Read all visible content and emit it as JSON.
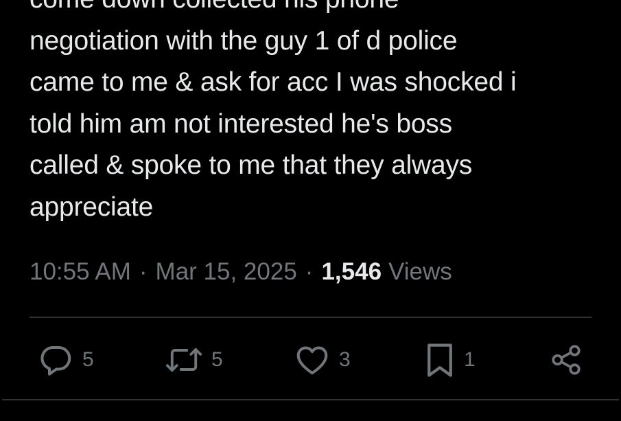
{
  "tweet": {
    "text_lines": [
      "come down collected his phone",
      "negotiation with the guy 1 of d police",
      "came to me & ask for acc I was shocked i",
      "told him am not interested he's boss",
      "called & spoke to me that they always",
      "appreciate"
    ],
    "time": "10:55 AM",
    "separator": "·",
    "date": "Mar 15, 2025",
    "views_count": "1,546",
    "views_label": "Views"
  },
  "actions": {
    "reply": {
      "icon": "reply-icon",
      "count": "5"
    },
    "repost": {
      "icon": "repost-icon",
      "count": "5"
    },
    "like": {
      "icon": "heart-icon",
      "count": "3"
    },
    "bookmark": {
      "icon": "bookmark-icon",
      "count": "1"
    },
    "share": {
      "icon": "share-icon"
    }
  },
  "colors": {
    "background": "#000000",
    "text": "#e7e9ea",
    "secondary_text": "#71767b",
    "divider": "#2f3336"
  }
}
